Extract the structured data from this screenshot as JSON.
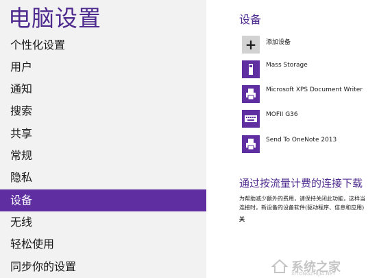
{
  "page_title": "电脑设置",
  "nav": {
    "items": [
      {
        "label": "个性化设置",
        "selected": false
      },
      {
        "label": "用户",
        "selected": false
      },
      {
        "label": "通知",
        "selected": false
      },
      {
        "label": "搜索",
        "selected": false
      },
      {
        "label": "共享",
        "selected": false
      },
      {
        "label": "常规",
        "selected": false
      },
      {
        "label": "隐私",
        "selected": false
      },
      {
        "label": "设备",
        "selected": true
      },
      {
        "label": "无线",
        "selected": false
      },
      {
        "label": "轻松使用",
        "selected": false
      },
      {
        "label": "同步你的设置",
        "selected": false
      }
    ]
  },
  "devices": {
    "title": "设备",
    "add_label": "添加设备",
    "items": [
      {
        "label": "Mass Storage",
        "icon": "usb-drive-icon"
      },
      {
        "label": "Microsoft XPS Document Writer",
        "icon": "printer-icon"
      },
      {
        "label": "MOFII G36",
        "icon": "keyboard-icon"
      },
      {
        "label": "Send To OneNote 2013",
        "icon": "printer-icon"
      }
    ]
  },
  "metered": {
    "title": "通过按流量计费的连接下载",
    "line1": "为帮助减少额外的费用，请保持关闭此功能，这样当",
    "line2": "连接时，新设备的设备软件(驱动程序、信息和应用)",
    "toggle_state": "关"
  },
  "watermark": {
    "text": "系统之家",
    "sub": "XITONGZHIJIA.NET"
  },
  "colors": {
    "accent": "#5f2ea1",
    "title": "#4e2a8e",
    "left_bg": "#f2f2f2"
  }
}
